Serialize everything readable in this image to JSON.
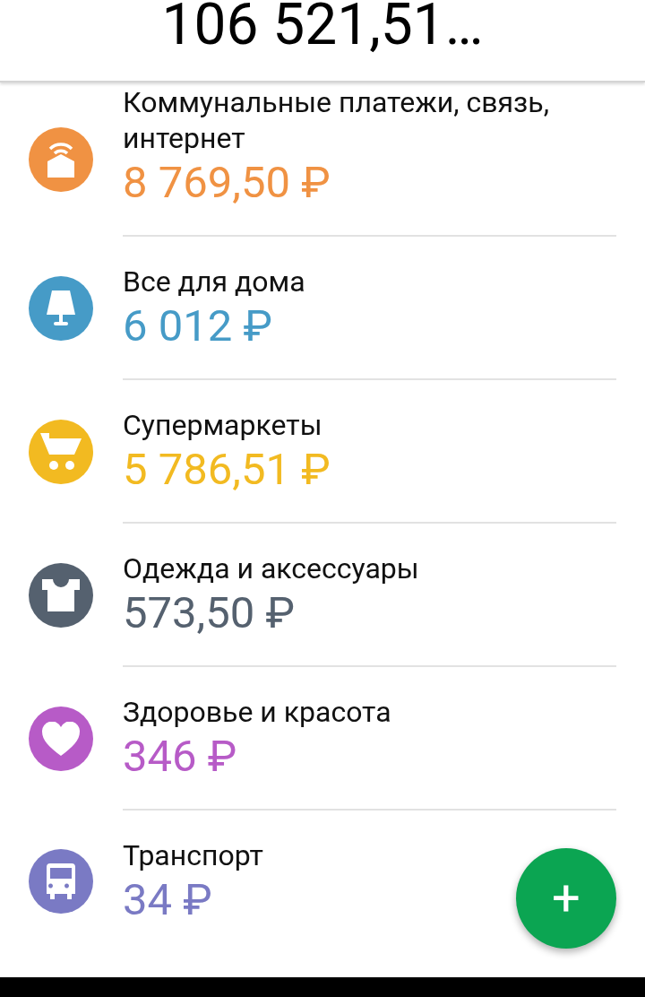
{
  "header": {
    "total": "106 521,51…"
  },
  "categories": [
    {
      "name": "Коммунальные платежи, связь, интернет",
      "amount": "8 769,50 ₽",
      "color": "#f09243"
    },
    {
      "name": "Все для дома",
      "amount": "6 012 ₽",
      "color": "#469bc7"
    },
    {
      "name": "Супермаркеты",
      "amount": "5 786,51 ₽",
      "color": "#f2ba21"
    },
    {
      "name": "Одежда и аксессуары",
      "amount": "573,50 ₽",
      "color": "#55616f"
    },
    {
      "name": "Здоровье и красота",
      "amount": "346 ₽",
      "color": "#b75bc7"
    },
    {
      "name": "Транспорт",
      "amount": "34 ₽",
      "color": "#7a7ac4"
    }
  ],
  "fab": {
    "label": "+"
  }
}
